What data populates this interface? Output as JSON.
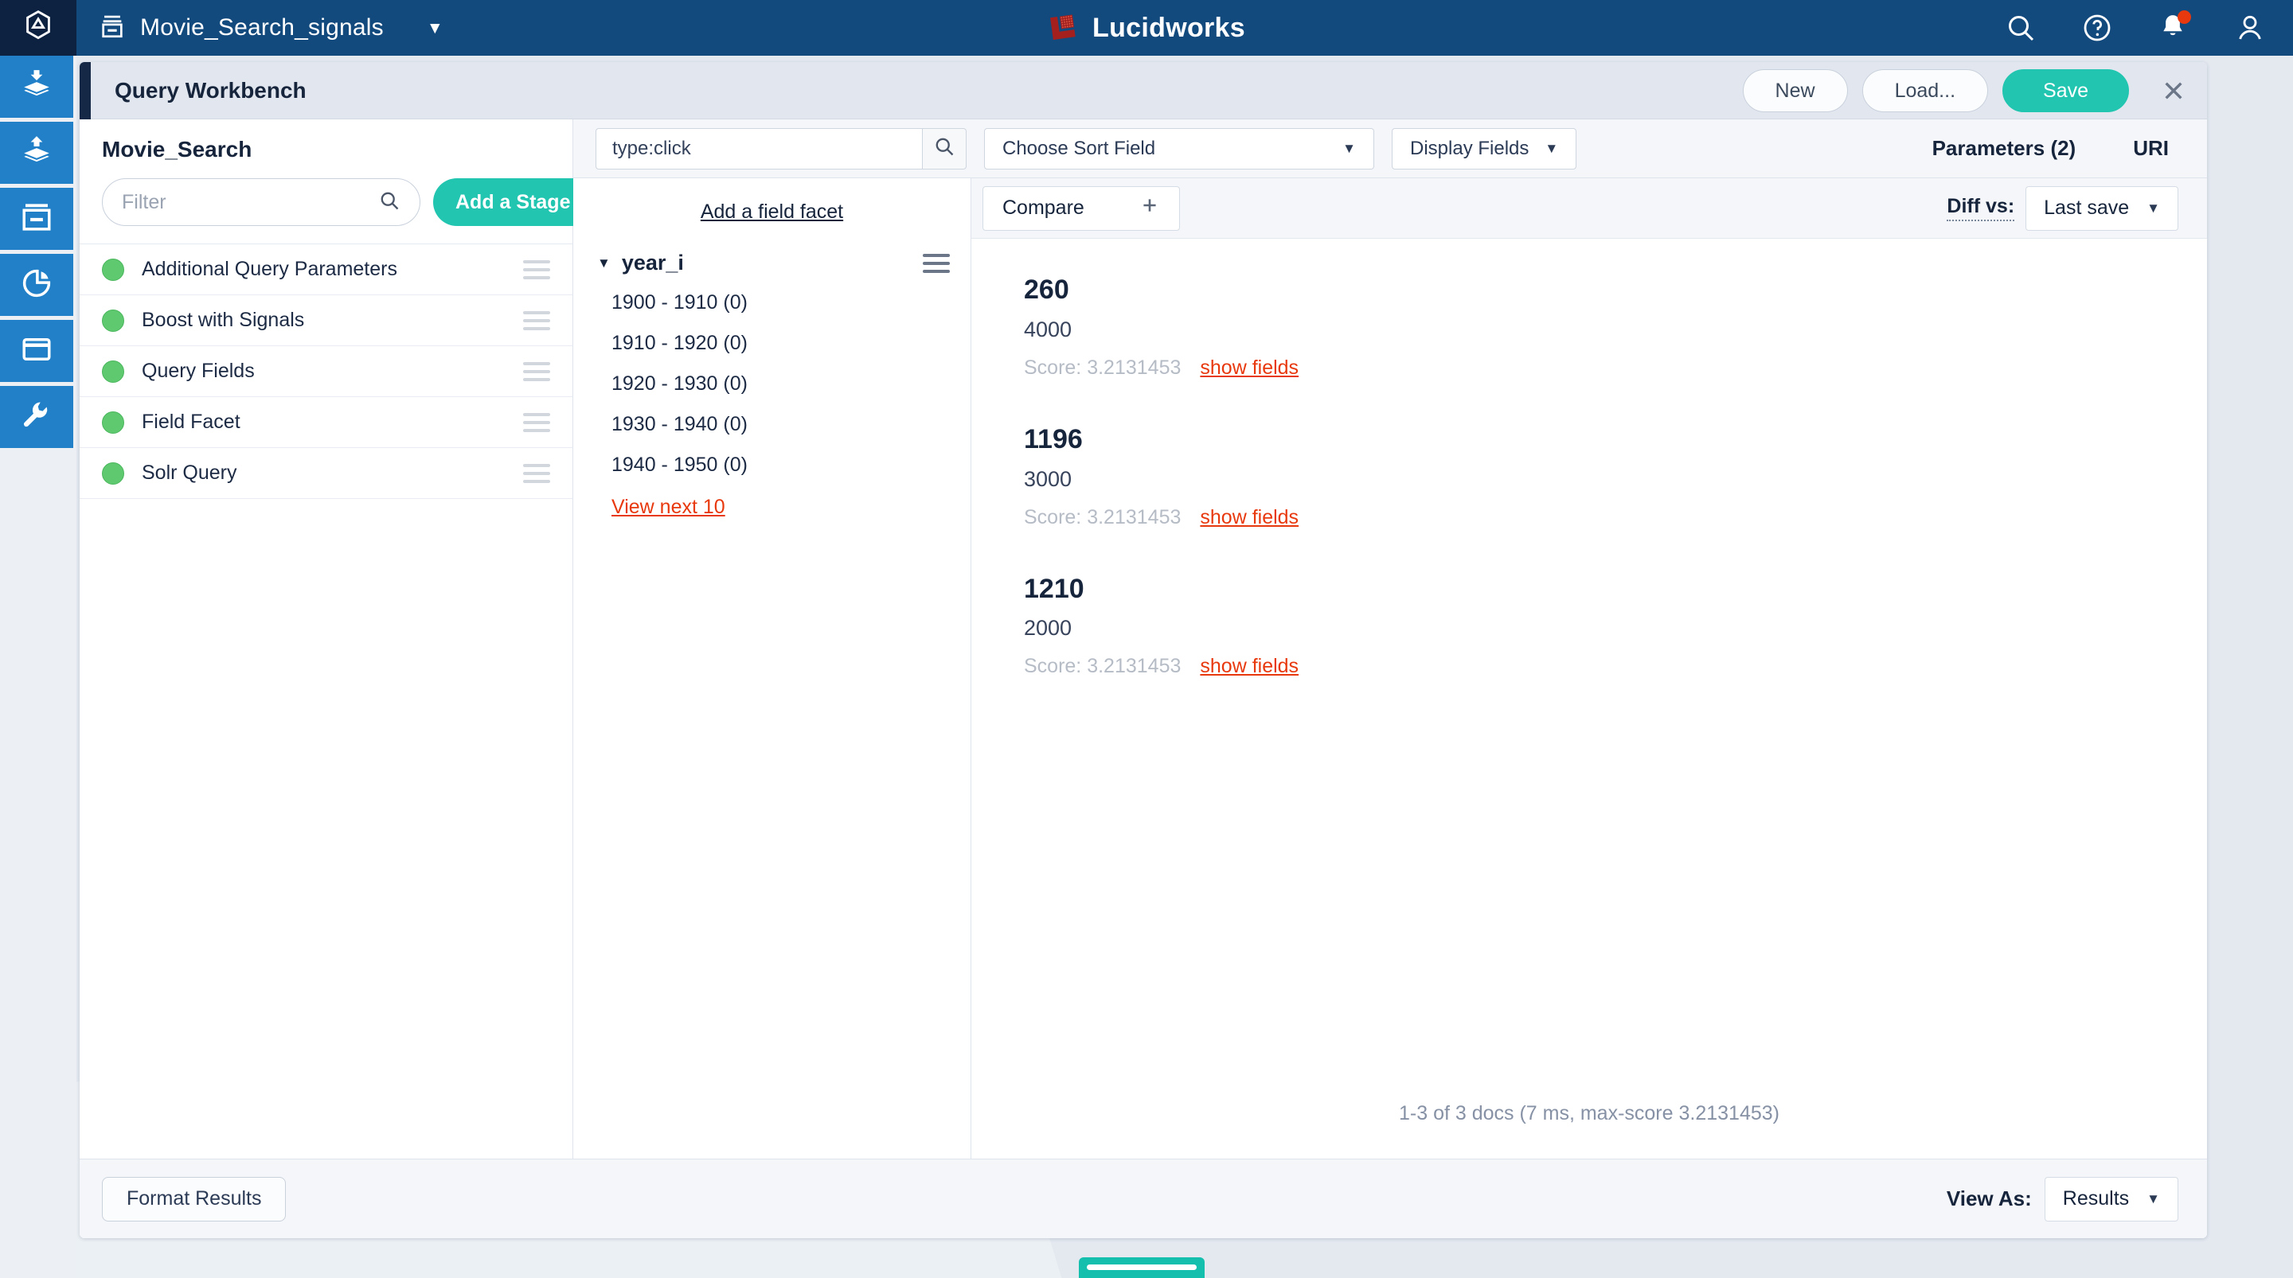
{
  "topnav": {
    "home_icon": "lucidworks-fusion-home-icon",
    "collection_icon": "collection-box-icon",
    "collection_name": "Movie_Search_signals",
    "collection_caret": "▼",
    "brand": "Lucidworks",
    "icons": {
      "search": "search-icon",
      "help": "help-circle-icon",
      "notifications": "bell-icon",
      "account": "user-account-icon"
    }
  },
  "rail": {
    "items": [
      {
        "icon": "index-layers-down-icon",
        "name": "indexing"
      },
      {
        "icon": "query-layers-up-icon",
        "name": "querying"
      },
      {
        "icon": "collections-box-icon",
        "name": "collections"
      },
      {
        "icon": "analytics-pie-chart-icon",
        "name": "analytics"
      },
      {
        "icon": "app-window-icon",
        "name": "apps"
      },
      {
        "icon": "wrench-tools-icon",
        "name": "devops"
      }
    ]
  },
  "workbench": {
    "title": "Query Workbench",
    "buttons": {
      "new": "New",
      "load": "Load...",
      "save": "Save"
    },
    "close_icon": "close-icon"
  },
  "stages": {
    "pipeline_name": "Movie_Search",
    "filter_placeholder": "Filter",
    "filter_value": "",
    "search_icon": "search-icon",
    "add_stage_label": "Add a Stage",
    "add_stage_caret": "▼",
    "items": [
      {
        "label": "Additional Query Parameters",
        "status_color": "#5ec96f"
      },
      {
        "label": "Boost with Signals",
        "status_color": "#5ec96f"
      },
      {
        "label": "Query Fields",
        "status_color": "#5ec96f"
      },
      {
        "label": "Field Facet",
        "status_color": "#5ec96f"
      },
      {
        "label": "Solr Query",
        "status_color": "#5ec96f"
      }
    ]
  },
  "querybar": {
    "query_value": "type:click",
    "query_placeholder": "",
    "search_icon": "search-icon",
    "sort_field_label": "Choose Sort Field",
    "display_fields_label": "Display Fields",
    "caret": "▼",
    "parameters_label": "Parameters (2)",
    "uri_label": "URI"
  },
  "facets": {
    "add_facet_label": "Add a field facet",
    "field_name": "year_i",
    "expand_caret": "▼",
    "values": [
      "1900 - 1910 (0)",
      "1910 - 1920 (0)",
      "1920 - 1930 (0)",
      "1930 - 1940 (0)",
      "1940 - 1950 (0)"
    ],
    "view_next_label": "View next 10",
    "view_next_color": "#e8380d"
  },
  "compare": {
    "compare_label": "Compare",
    "plus_icon": "plus-icon",
    "diff_label": "Diff vs:",
    "diff_value": "Last save",
    "caret": "▼"
  },
  "results": {
    "show_fields_label": "show fields",
    "score_prefix": "Score: ",
    "docs": [
      {
        "title": "260",
        "subtitle": "4000",
        "score": "3.2131453"
      },
      {
        "title": "1196",
        "subtitle": "3000",
        "score": "3.2131453"
      },
      {
        "title": "1210",
        "subtitle": "2000",
        "score": "3.2131453"
      }
    ],
    "summary": "1-3 of 3 docs (7 ms, max-score 3.2131453)"
  },
  "footer": {
    "format_results_label": "Format Results",
    "view_as_label": "View As:",
    "view_as_value": "Results",
    "caret": "▼"
  },
  "colors": {
    "nav_blue": "#134a7e",
    "rail_blue": "#2180c8",
    "teal_accent": "#21c5b0",
    "link_orange": "#e8380d",
    "status_green": "#5ec96f",
    "dark_navy": "#152846"
  }
}
